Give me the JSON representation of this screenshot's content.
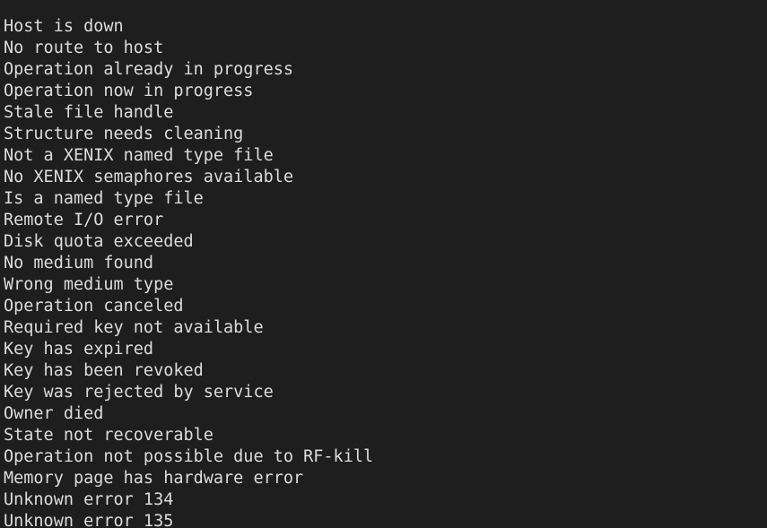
{
  "terminal": {
    "background_color": "#1e1e1e",
    "foreground_color": "#dcdcdc",
    "lines": [
      "Host is down",
      "No route to host",
      "Operation already in progress",
      "Operation now in progress",
      "Stale file handle",
      "Structure needs cleaning",
      "Not a XENIX named type file",
      "No XENIX semaphores available",
      "Is a named type file",
      "Remote I/O error",
      "Disk quota exceeded",
      "No medium found",
      "Wrong medium type",
      "Operation canceled",
      "Required key not available",
      "Key has expired",
      "Key has been revoked",
      "Key was rejected by service",
      "Owner died",
      "State not recoverable",
      "Operation not possible due to RF-kill",
      "Memory page has hardware error",
      "Unknown error 134",
      "Unknown error 135"
    ]
  }
}
